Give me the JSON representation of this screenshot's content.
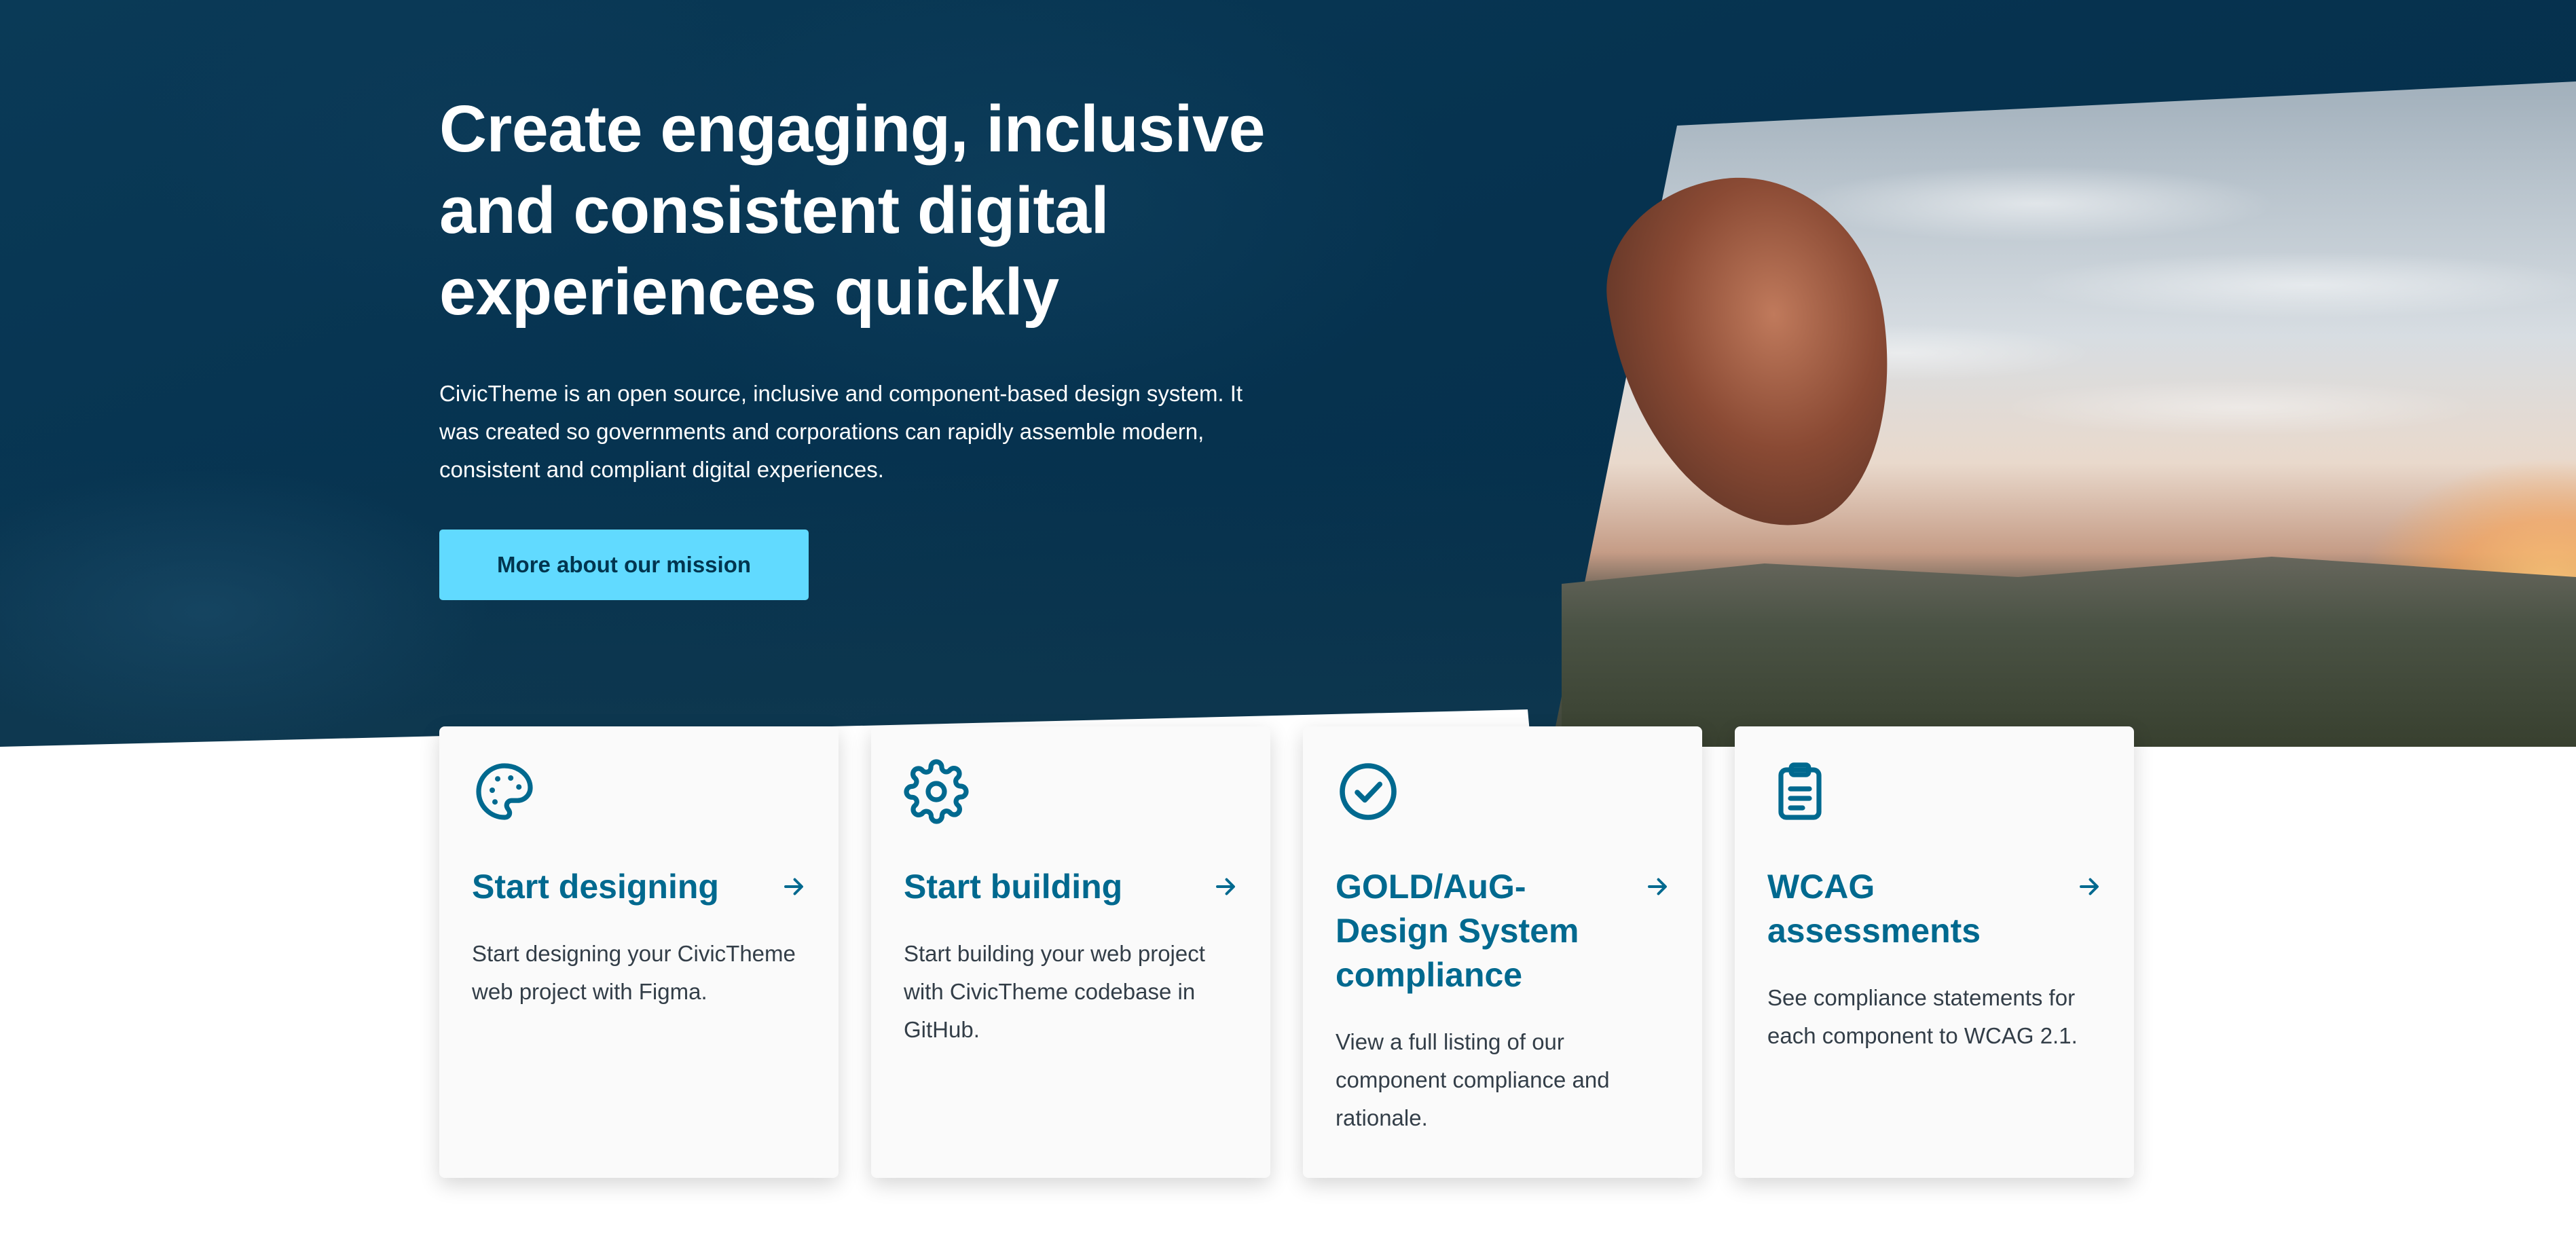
{
  "hero": {
    "title": "Create engaging, inclusive and consistent digital experiences quickly",
    "description": "CivicTheme is an open source, inclusive and component-based design system. It was created so governments and corporations can rapidly assemble modern, consistent and compliant digital experiences.",
    "cta_label": "More about our mission"
  },
  "cards": [
    {
      "icon": "palette-icon",
      "title": "Start designing",
      "description": "Start designing your CivicTheme web project with Figma."
    },
    {
      "icon": "gear-icon",
      "title": "Start building",
      "description": "Start building your web project with CivicTheme codebase in GitHub."
    },
    {
      "icon": "check-circle-icon",
      "title": "GOLD/AuG-Design System compliance",
      "description": "View a full listing of our component compliance and rationale."
    },
    {
      "icon": "clipboard-icon",
      "title": "WCAG assessments",
      "description": "See compliance statements for each component to WCAG 2.1."
    }
  ],
  "colors": {
    "hero_bg": "#063350",
    "cta_bg": "#61daff",
    "cta_text": "#00354f",
    "card_title": "#00698f",
    "card_bg": "#fafafa",
    "body_text": "#333e48"
  }
}
